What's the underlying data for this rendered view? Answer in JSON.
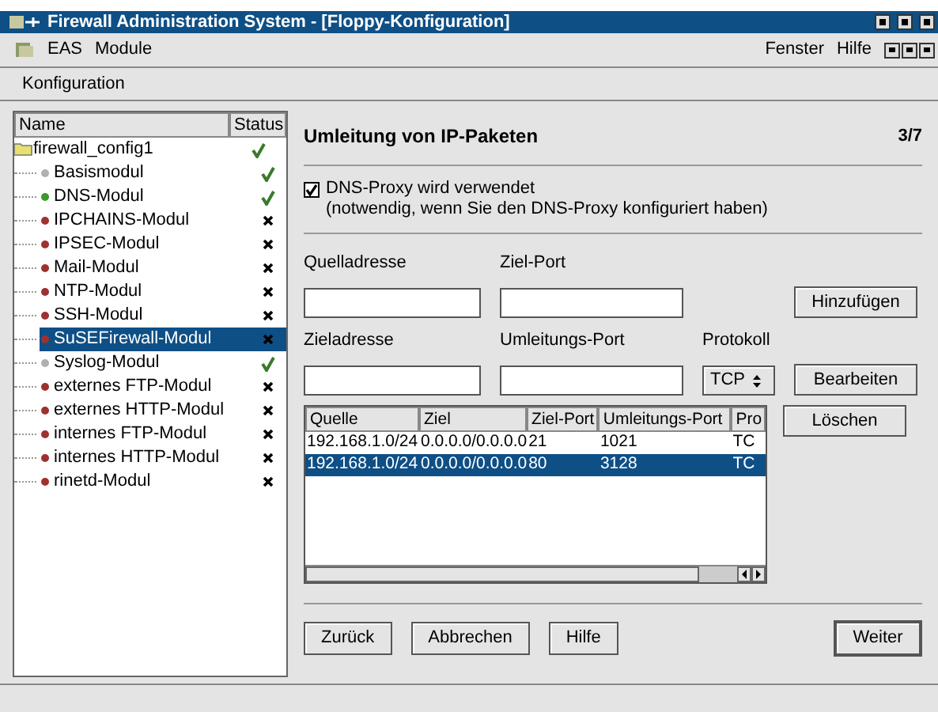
{
  "window": {
    "title": "Firewall Administration System - [Floppy-Konfiguration]"
  },
  "menu": [
    "EAS",
    "Module"
  ],
  "menu_right": [
    "Fenster",
    "Hilfe"
  ],
  "toolbar": [
    "Konfiguration"
  ],
  "tree": {
    "columns": [
      "Name",
      "Status"
    ],
    "root": {
      "label": "firewall_config1",
      "ok": true,
      "children": [
        {
          "label": "Basismodul",
          "color": "#b0b0b0",
          "ok": true,
          "selected": false
        },
        {
          "label": "DNS-Modul",
          "color": "#3a9a2a",
          "ok": true,
          "selected": false
        },
        {
          "label": "IPCHAINS-Modul",
          "color": "#a03030",
          "ok": false,
          "selected": false
        },
        {
          "label": "IPSEC-Modul",
          "color": "#a03030",
          "ok": false,
          "selected": false
        },
        {
          "label": "Mail-Modul",
          "color": "#a03030",
          "ok": false,
          "selected": false
        },
        {
          "label": "NTP-Modul",
          "color": "#a03030",
          "ok": false,
          "selected": false
        },
        {
          "label": "SSH-Modul",
          "color": "#a03030",
          "ok": false,
          "selected": false
        },
        {
          "label": "SuSEFirewall-Modul",
          "color": "#a03030",
          "ok": false,
          "selected": true
        },
        {
          "label": "Syslog-Modul",
          "color": "#b0b0b0",
          "ok": true,
          "selected": false
        },
        {
          "label": "externes FTP-Modul",
          "color": "#a03030",
          "ok": false,
          "selected": false
        },
        {
          "label": "externes HTTP-Modul",
          "color": "#a03030",
          "ok": false,
          "selected": false
        },
        {
          "label": "internes FTP-Modul",
          "color": "#a03030",
          "ok": false,
          "selected": false
        },
        {
          "label": "internes HTTP-Modul",
          "color": "#a03030",
          "ok": false,
          "selected": false
        },
        {
          "label": "rinetd-Modul",
          "color": "#a03030",
          "ok": false,
          "selected": false
        }
      ]
    }
  },
  "panel": {
    "title": "Umleitung von IP-Paketen",
    "step": "3/7",
    "checkbox": {
      "label": "DNS-Proxy wird verwendet",
      "note": "(notwendig, wenn Sie den DNS-Proxy konfiguriert haben)",
      "checked": true
    },
    "fields": [
      {
        "label": "Quelladresse"
      },
      {
        "label": "Ziel-Port"
      },
      {
        "label": "Zieladresse"
      },
      {
        "label": "Umleitungs-Port"
      }
    ],
    "protocol": {
      "label": "Protokoll",
      "value": "TCP"
    },
    "side_buttons": [
      "Hinzufügen",
      "Bearbeiten",
      "Löschen"
    ],
    "table": {
      "columns": [
        "Quelle",
        "Ziel",
        "Ziel-Port",
        "Umleitungs-Port",
        "Pro"
      ],
      "rows": [
        {
          "cells": [
            "192.168.1.0/24",
            "0.0.0.0/0.0.0.0",
            "21",
            "1021",
            "TC"
          ],
          "selected": false
        },
        {
          "cells": [
            "192.168.1.0/24",
            "0.0.0.0/0.0.0.0",
            "80",
            "3128",
            "TC"
          ],
          "selected": true
        }
      ]
    },
    "nav_buttons": [
      "Zurück",
      "Abbrechen",
      "Hilfe"
    ],
    "next_button": "Weiter"
  }
}
